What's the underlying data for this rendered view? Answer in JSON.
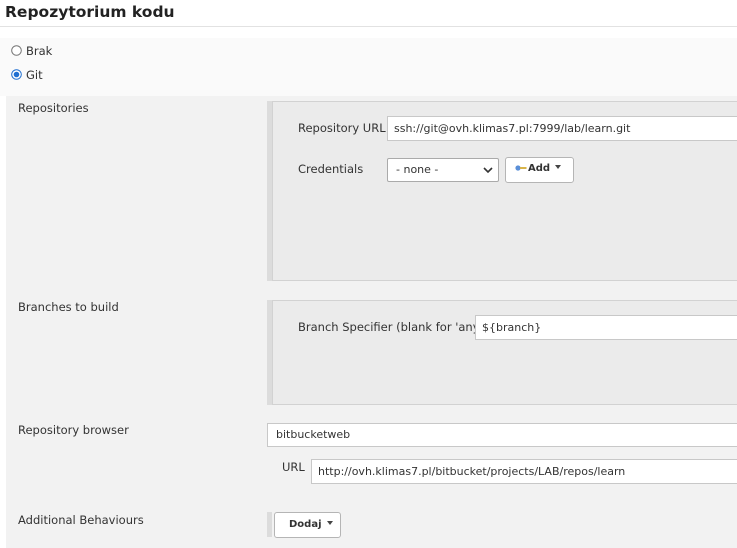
{
  "header": {
    "title": "Repozytorium kodu"
  },
  "scm_options": [
    {
      "label": "Brak",
      "selected": false
    },
    {
      "label": "Git",
      "selected": true
    }
  ],
  "repositories": {
    "label": "Repositories",
    "url_label": "Repository URL",
    "url_value": "ssh://git@ovh.klimas7.pl:7999/lab/learn.git",
    "credentials_label": "Credentials",
    "credentials_value": "- none -",
    "add_label": "Add"
  },
  "branches": {
    "label": "Branches to build",
    "specifier_label": "Branch Specifier (blank for 'any')",
    "specifier_value": "${branch}"
  },
  "browser": {
    "label": "Repository browser",
    "value": "bitbucketweb",
    "url_label": "URL",
    "url_value": "http://ovh.klimas7.pl/bitbucket/projects/LAB/repos/learn"
  },
  "behaviours": {
    "label": "Additional Behaviours",
    "add_label": "Dodaj"
  },
  "colors": {
    "background": "#ffffff",
    "section_background": "#f2f2f2",
    "group_background": "#ebebeb",
    "radio_accent": "#1f6fd1"
  }
}
